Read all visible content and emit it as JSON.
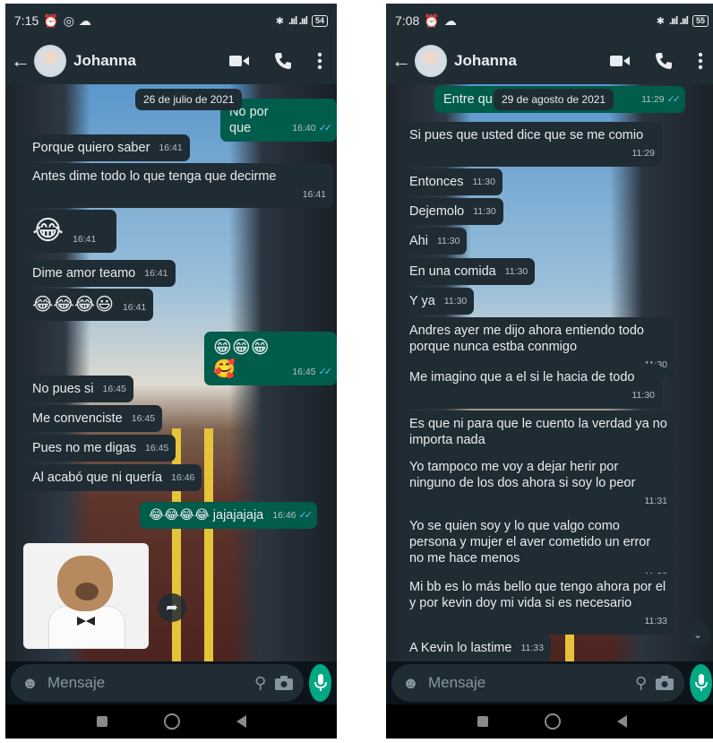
{
  "left": {
    "status": {
      "time": "7:15",
      "battery": "54"
    },
    "header": {
      "back": "←",
      "contact_name": "Johanna"
    },
    "date_chip": "26 de julio de 2021",
    "messages": [
      {
        "text": "No por que",
        "time": "16:40",
        "dir": "out",
        "ticks": "✓✓"
      },
      {
        "text": "Porque quiero saber",
        "time": "16:41",
        "dir": "in"
      },
      {
        "text": "Antes dime todo lo que tenga que decirme",
        "time": "16:41",
        "dir": "in"
      },
      {
        "text": "😂",
        "time": "16:41",
        "dir": "in"
      },
      {
        "text": "Dime amor teamo",
        "time": "16:41",
        "dir": "in"
      },
      {
        "text": "😂😂😂😃",
        "time": "16:41",
        "dir": "in"
      },
      {
        "text": "😁😁😁🥰",
        "time": "16:45",
        "dir": "out",
        "ticks": "✓✓"
      },
      {
        "text": "No pues si",
        "time": "16:45",
        "dir": "in"
      },
      {
        "text": "Me convenciste",
        "time": "16:45",
        "dir": "in"
      },
      {
        "text": "Pues no me digas",
        "time": "16:45",
        "dir": "in"
      },
      {
        "text": "Al acabó que ni quería",
        "time": "16:46",
        "dir": "in"
      },
      {
        "text": "😂😂😂😂 jajajajaja",
        "time": "16:46",
        "dir": "out",
        "ticks": "✓✓"
      }
    ],
    "input": {
      "placeholder": "Mensaje"
    }
  },
  "right": {
    "status": {
      "time": "7:08",
      "battery": "55"
    },
    "header": {
      "back": "←",
      "contact_name": "Johanna"
    },
    "date_chip": "29 de agosto de 2021",
    "messages": [
      {
        "text": "Entre qu",
        "time": "11:29",
        "dir": "out",
        "ticks": "✓✓"
      },
      {
        "text": "Si pues que usted dice que se me comio",
        "time": "11:29",
        "dir": "in"
      },
      {
        "text": "Entonces",
        "time": "11:30",
        "dir": "in"
      },
      {
        "text": "Dejemolo",
        "time": "11:30",
        "dir": "in"
      },
      {
        "text": "Ahi",
        "time": "11:30",
        "dir": "in"
      },
      {
        "text": "En una comida",
        "time": "11:30",
        "dir": "in"
      },
      {
        "text": "Y ya",
        "time": "11:30",
        "dir": "in"
      },
      {
        "text": "Andres ayer me dijo ahora entiendo todo porque nunca estba conmigo",
        "time": "11:30",
        "dir": "in"
      },
      {
        "text": "Me imagino que a el si le hacia de todo",
        "time": "11:30",
        "dir": "in"
      },
      {
        "text": "Es que ni para que le cuento la verdad ya no importa nada",
        "time": "11:31",
        "dir": "in"
      },
      {
        "text": "Yo tampoco me voy a dejar herir por ninguno de los dos ahora si soy lo peor",
        "time": "11:31",
        "dir": "in"
      },
      {
        "text": "Yo se quien soy y lo que valgo como persona y mujer el aver cometido un error no me hace menos",
        "time": "11:32",
        "dir": "in"
      },
      {
        "text": "Mi bb es lo más bello que tengo ahora por el y por kevin doy mi vida si es necesario",
        "time": "11:33",
        "dir": "in"
      },
      {
        "text": "A Kevin lo lastime",
        "time": "11:33",
        "dir": "in"
      }
    ],
    "input": {
      "placeholder": "Mensaje"
    }
  },
  "colors": {
    "incoming_bubble": "#1f2c34",
    "outgoing_bubble": "#005c4b",
    "accent": "#00a884",
    "read_ticks": "#53bdeb"
  }
}
